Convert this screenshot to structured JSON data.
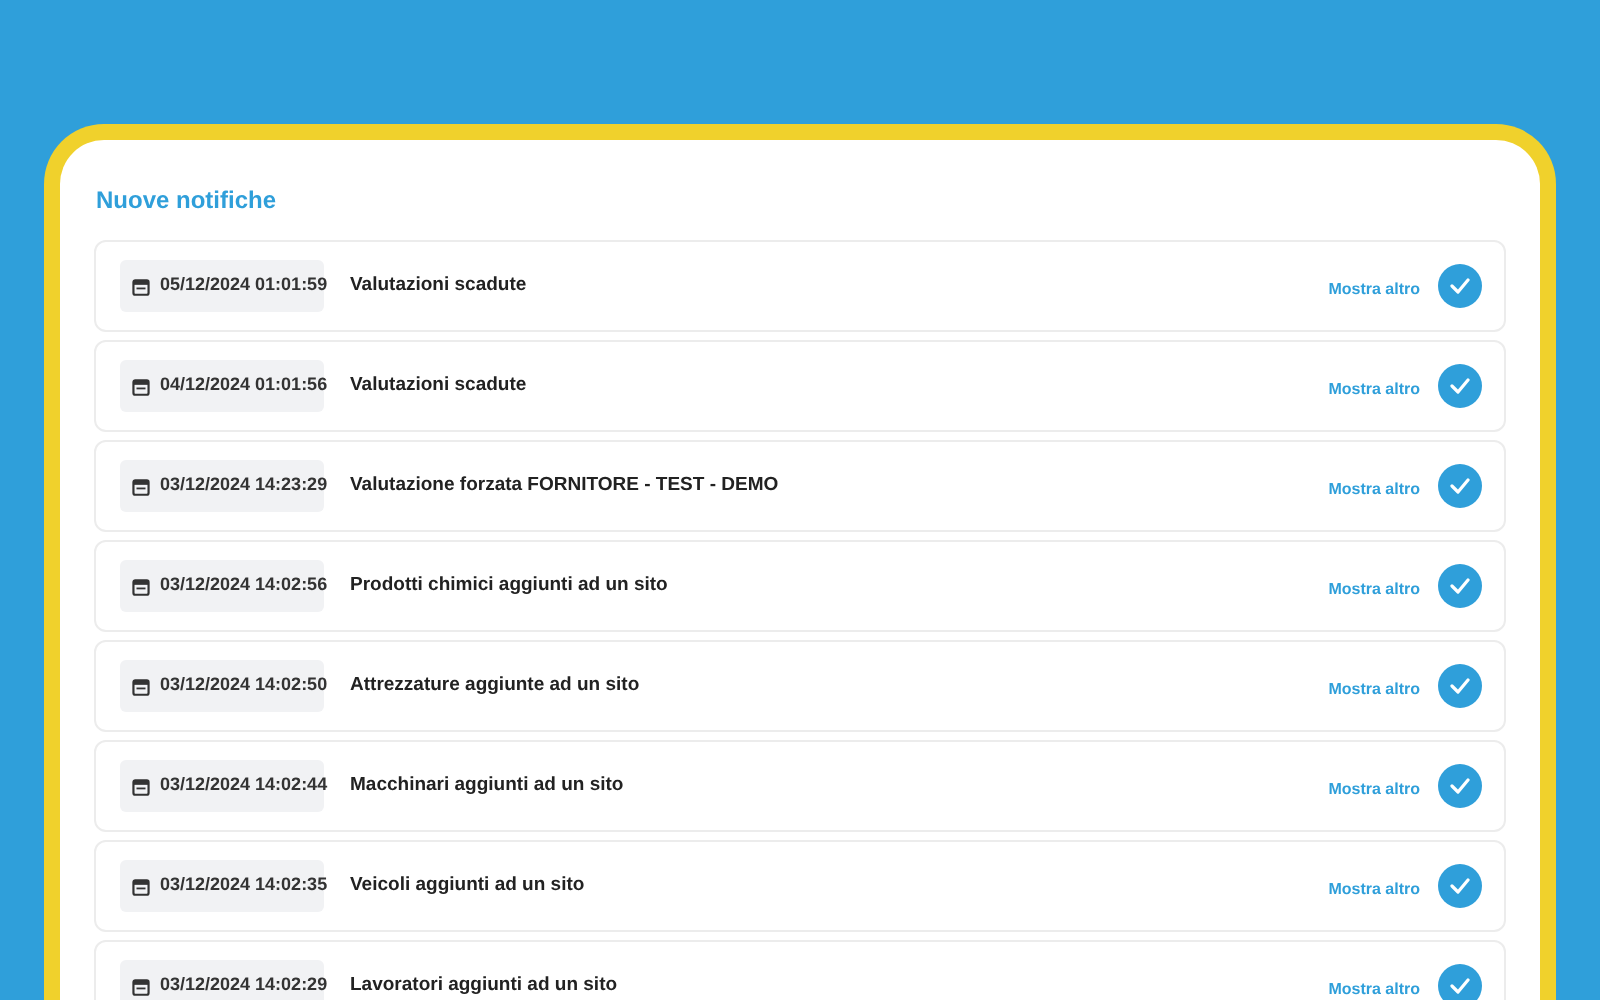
{
  "title": "Nuove notifiche",
  "notifications": [
    {
      "date": "05/12/2024 01:01:59",
      "text": "Valutazioni scadute",
      "link": "Mostra altro"
    },
    {
      "date": "04/12/2024 01:01:56",
      "text": "Valutazioni scadute",
      "link": "Mostra altro"
    },
    {
      "date": "03/12/2024 14:23:29",
      "text": "Valutazione forzata FORNITORE - TEST - DEMO",
      "link": "Mostra altro"
    },
    {
      "date": "03/12/2024 14:02:56",
      "text": "Prodotti chimici aggiunti ad un sito",
      "link": "Mostra altro"
    },
    {
      "date": "03/12/2024 14:02:50",
      "text": "Attrezzature aggiunte ad un sito",
      "link": "Mostra altro"
    },
    {
      "date": "03/12/2024 14:02:44",
      "text": "Macchinari aggiunti ad un sito",
      "link": "Mostra altro"
    },
    {
      "date": "03/12/2024 14:02:35",
      "text": "Veicoli aggiunti ad un sito",
      "link": "Mostra altro"
    },
    {
      "date": "03/12/2024 14:02:29",
      "text": "Lavoratori aggiunti ad un sito",
      "link": "Mostra altro"
    }
  ]
}
